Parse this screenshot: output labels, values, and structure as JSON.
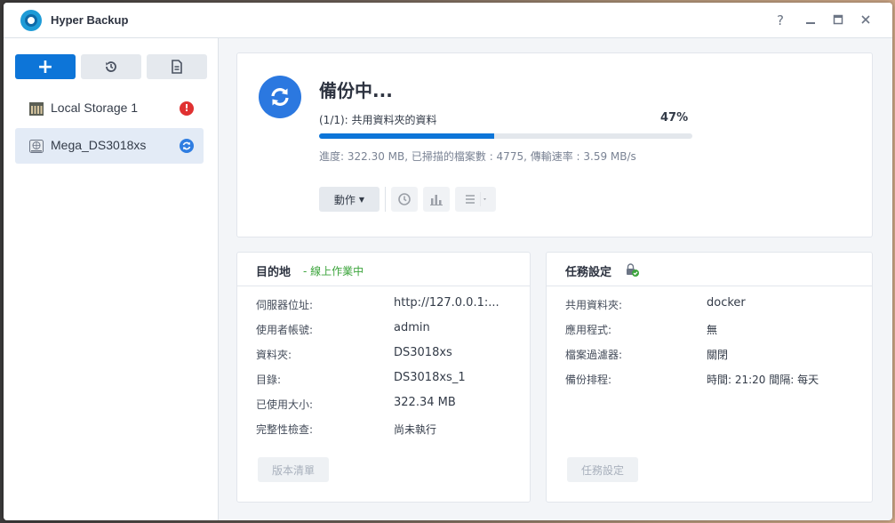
{
  "window": {
    "title": "Hyper Backup",
    "controls": {
      "help": "?",
      "minimize": "–",
      "maximize": "□",
      "close": "✕"
    }
  },
  "sidebar": {
    "buttons": {
      "add": "+",
      "history_icon": "history-icon",
      "log_icon": "document-icon"
    },
    "tasks": [
      {
        "label": "Local Storage 1",
        "status": "error",
        "status_glyph": "!"
      },
      {
        "label": "Mega_DS3018xs",
        "status": "running",
        "status_glyph": "⟳",
        "selected": true
      }
    ]
  },
  "backup": {
    "title": "備份中...",
    "task": "(1/1): 共用資料夾的資料",
    "percent_text": "47%",
    "progress": 0.47,
    "detail": "進度: 322.30 MB, 已掃描的檔案數 : 4775, 傳輸速率 : 3.59 MB/s",
    "action_label": "動作"
  },
  "destination": {
    "title": "目的地",
    "status": "- 線上作業中",
    "rows": [
      {
        "label": "伺服器位址:",
        "value": "http://127.0.0.1:..."
      },
      {
        "label": "使用者帳號:",
        "value": "admin"
      },
      {
        "label": "資料夾:",
        "value": "DS3018xs"
      },
      {
        "label": "目錄:",
        "value": "DS3018xs_1"
      },
      {
        "label": "已使用大小:",
        "value": "322.34 MB"
      },
      {
        "label": "完整性檢查:",
        "value": "尚未執行"
      }
    ],
    "button": "版本清單"
  },
  "task_settings": {
    "title": "任務設定",
    "rows": [
      {
        "label": "共用資料夾:",
        "value": "docker"
      },
      {
        "label": "應用程式:",
        "value": "無"
      },
      {
        "label": "檔案過濾器:",
        "value": "關閉"
      },
      {
        "label": "備份排程:",
        "value": "時間: 21:20 間隔: 每天"
      }
    ],
    "button": "任務設定"
  },
  "colors": {
    "accent": "#0d75d8",
    "online": "#3da53d",
    "error": "#e03131"
  }
}
